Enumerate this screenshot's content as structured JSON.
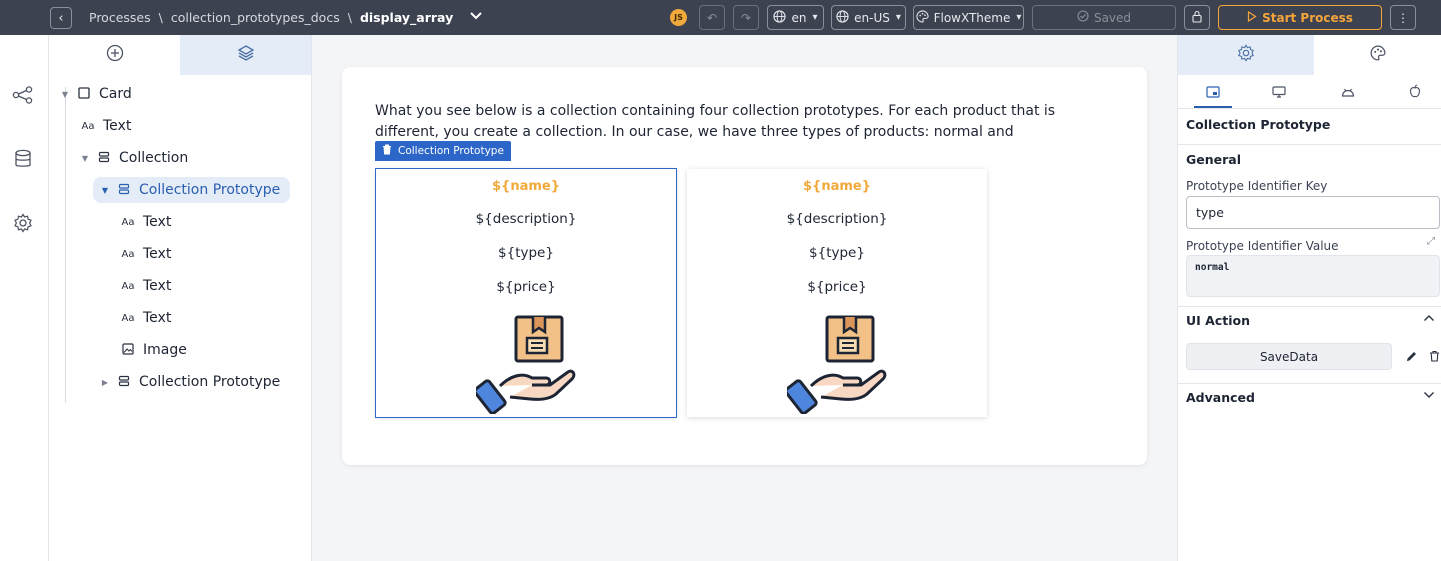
{
  "topbar": {
    "breadcrumb": [
      "Processes",
      "collection_prototypes_docs",
      "display_array"
    ],
    "separator": "\\",
    "avatar_initials": "JS",
    "language": "en",
    "locale": "en-US",
    "theme": "FlowXTheme",
    "saved_label": "Saved",
    "start_label": "Start Process"
  },
  "tree": {
    "nodes": [
      {
        "label": "Card"
      },
      {
        "label": "Text"
      },
      {
        "label": "Collection"
      },
      {
        "label": "Collection Prototype"
      },
      {
        "label": "Text"
      },
      {
        "label": "Text"
      },
      {
        "label": "Text"
      },
      {
        "label": "Text"
      },
      {
        "label": "Image"
      },
      {
        "label": "Collection Prototype"
      }
    ]
  },
  "canvas": {
    "intro_text": "What you see below is a collection containing four collection prototypes. For each product that is different, you create a collection. In our case, we have three types of products: normal and recommended.",
    "selected_tag": "Collection Prototype",
    "prototypes": [
      {
        "name": "${name}",
        "description": "${description}",
        "type": "${type}",
        "price": "${price}"
      },
      {
        "name": "${name}",
        "description": "${description}",
        "type": "${type}",
        "price": "${price}"
      }
    ]
  },
  "right": {
    "component_title": "Collection Prototype",
    "general_title": "General",
    "key_label": "Prototype Identifier Key",
    "key_value": "type",
    "value_label": "Prototype Identifier Value",
    "value_code": "normal",
    "ui_action_title": "UI Action",
    "ui_action_button": "SaveData",
    "advanced_title": "Advanced"
  },
  "colors": {
    "topbar": "#3d4250",
    "accent": "#2d66c9",
    "placeholder_orange": "#f2a93b",
    "start_orange": "#f6a53a"
  }
}
